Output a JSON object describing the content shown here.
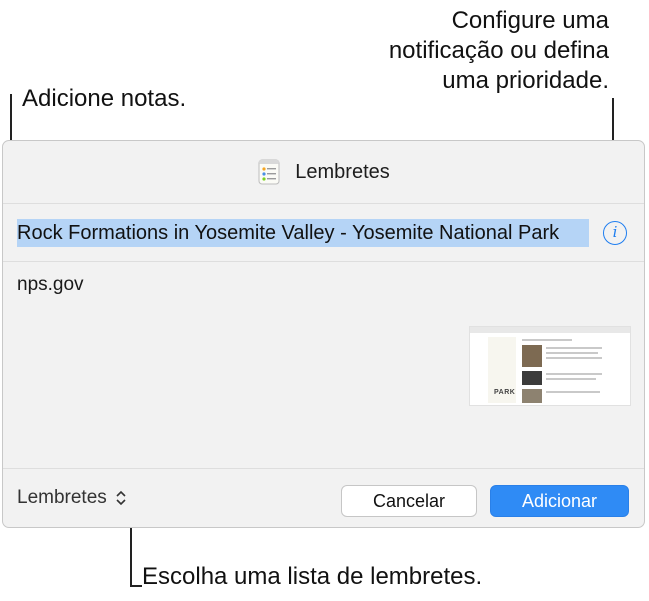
{
  "callouts": {
    "top_right_line1": "Configure uma",
    "top_right_line2": "notificação ou defina",
    "top_right_line3": "uma prioridade.",
    "left": "Adicione notas.",
    "bottom": "Escolha uma lista de lembretes."
  },
  "dialog": {
    "title": "Lembretes",
    "app_icon": "reminders-app-icon",
    "reminder_title": "Rock Formations in Yosemite Valley - Yosemite National Park",
    "notes": "nps.gov",
    "info_icon": "info-icon",
    "info_glyph": "i",
    "thumbnail_icon": "webpage-thumbnail",
    "thumbnail_park_text": "PARK",
    "list_name": "Lembretes",
    "list_chevron_icon": "up-down-chevron-icon",
    "cancel_label": "Cancelar",
    "add_label": "Adicionar"
  },
  "colors": {
    "accent": "#2f8bf5",
    "selection": "#b5d4f6",
    "background": "#f2f2f2"
  }
}
